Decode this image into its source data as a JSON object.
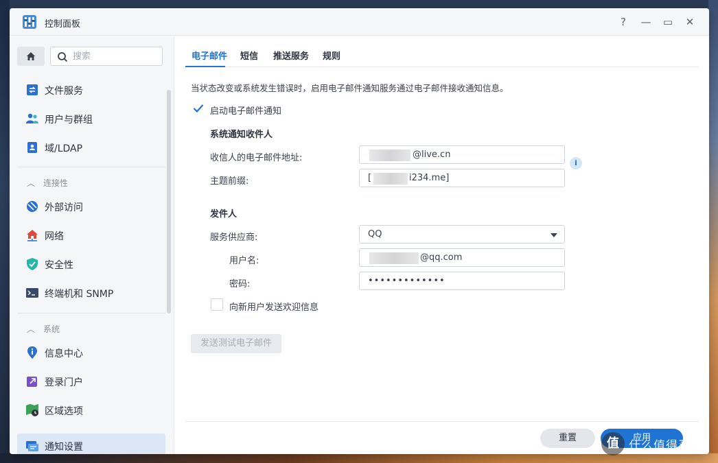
{
  "window": {
    "title": "控制面板"
  },
  "titlebar_controls": {
    "help": "?",
    "minimize": "—",
    "maximize": "▭",
    "close": "✕"
  },
  "sidebar": {
    "search_placeholder": "搜索",
    "items": [
      {
        "label": "文件服务",
        "icon": "file-services-icon"
      },
      {
        "label": "用户与群组",
        "icon": "users-groups-icon"
      },
      {
        "label": "域/LDAP",
        "icon": "domain-ldap-icon"
      }
    ],
    "section_connectivity": "连接性",
    "connectivity_items": [
      {
        "label": "外部访问",
        "icon": "external-access-icon"
      },
      {
        "label": "网络",
        "icon": "network-icon"
      },
      {
        "label": "安全性",
        "icon": "security-shield-icon"
      },
      {
        "label": "终端机和 SNMP",
        "icon": "terminal-icon"
      }
    ],
    "section_system": "系统",
    "system_items": [
      {
        "label": "信息中心",
        "icon": "info-center-icon"
      },
      {
        "label": "登录门户",
        "icon": "login-portal-icon"
      },
      {
        "label": "区域选项",
        "icon": "regional-options-icon"
      },
      {
        "label": "通知设置",
        "icon": "notification-icon",
        "active": true
      }
    ]
  },
  "tabs": [
    {
      "label": "电子邮件",
      "active": true
    },
    {
      "label": "短信"
    },
    {
      "label": "推送服务"
    },
    {
      "label": "规则"
    }
  ],
  "email": {
    "description": "当状态改变或系统发生错误时，启用电子邮件通知服务通过电子邮件接收通知信息。",
    "enable_label": "启动电子邮件通知",
    "enable_checked": true,
    "recipients_heading": "系统通知收件人",
    "recipient_label": "收信人的电子邮件地址:",
    "recipient_value": "@live.cn",
    "subject_label": "主题前缀:",
    "subject_value_start": "[",
    "subject_value_end": "i234.me]",
    "sender_heading": "发件人",
    "provider_label": "服务供应商:",
    "provider_value": "QQ",
    "username_label": "用户名:",
    "username_value": "@qq.com",
    "password_label": "密码:",
    "password_value": "•••••••••••••",
    "welcome_label": "向新用户发送欢迎信息",
    "welcome_checked": false,
    "test_button": "发送测试电子邮件"
  },
  "footer": {
    "reset": "重置",
    "apply": "应用"
  },
  "watermark": {
    "badge": "值",
    "text": "什么值得买"
  },
  "colors": {
    "accent": "#1e73d3",
    "active_bg": "#dbe7f5"
  }
}
